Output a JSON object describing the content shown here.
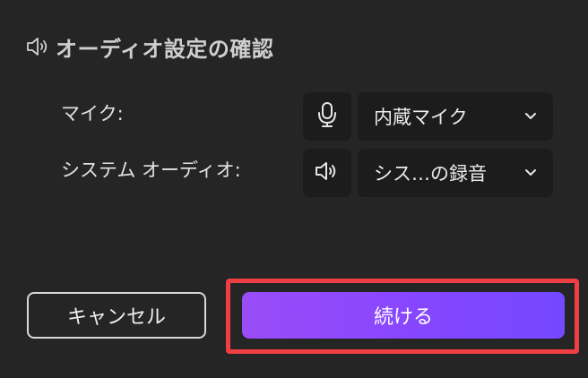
{
  "header": {
    "title": "オーディオ設定の確認",
    "icon": "speaker-icon"
  },
  "microphone": {
    "label": "マイク:",
    "icon": "microphone-icon",
    "selected": "内蔵マイク"
  },
  "system_audio": {
    "label": "システム オーディオ:",
    "icon": "speaker-icon",
    "selected": "シス…の録音"
  },
  "actions": {
    "cancel_label": "キャンセル",
    "continue_label": "続ける"
  },
  "colors": {
    "background": "#252526",
    "control_bg": "#1c1c1d",
    "accent_start": "#9a4cf7",
    "accent_end": "#7448ff",
    "highlight": "#ef3f45"
  }
}
